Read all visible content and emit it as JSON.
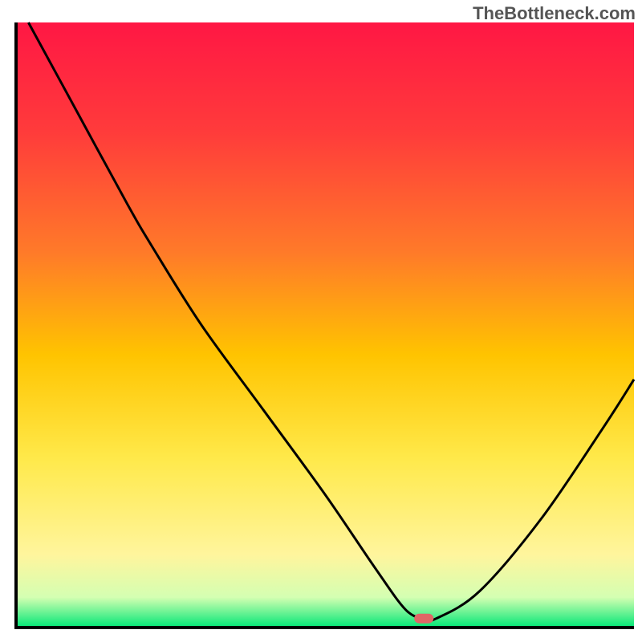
{
  "watermark": "TheBottleneck.com",
  "chart_data": {
    "type": "line",
    "title": "",
    "xlabel": "",
    "ylabel": "",
    "xlim": [
      0,
      100
    ],
    "ylim": [
      0,
      100
    ],
    "grid": false,
    "legend": false,
    "marker": {
      "x": 66,
      "y": 1.5,
      "color": "#e06666"
    },
    "series": [
      {
        "name": "bottleneck-curve",
        "x": [
          2,
          10,
          18,
          22,
          30,
          40,
          50,
          58,
          63,
          66,
          68,
          75,
          85,
          95,
          100
        ],
        "y": [
          100,
          85,
          70,
          63,
          50,
          36,
          22,
          10,
          3,
          1.5,
          1.5,
          6,
          18,
          33,
          41
        ]
      }
    ],
    "gradient_stops": [
      {
        "offset": 0.0,
        "color": "#ff1744"
      },
      {
        "offset": 0.18,
        "color": "#ff3b3b"
      },
      {
        "offset": 0.38,
        "color": "#ff7a29"
      },
      {
        "offset": 0.55,
        "color": "#ffc400"
      },
      {
        "offset": 0.72,
        "color": "#ffe94a"
      },
      {
        "offset": 0.88,
        "color": "#fff59d"
      },
      {
        "offset": 0.95,
        "color": "#d4ffb2"
      },
      {
        "offset": 1.0,
        "color": "#00e676"
      }
    ],
    "axis_color": "#000000",
    "line_color": "#000000"
  }
}
